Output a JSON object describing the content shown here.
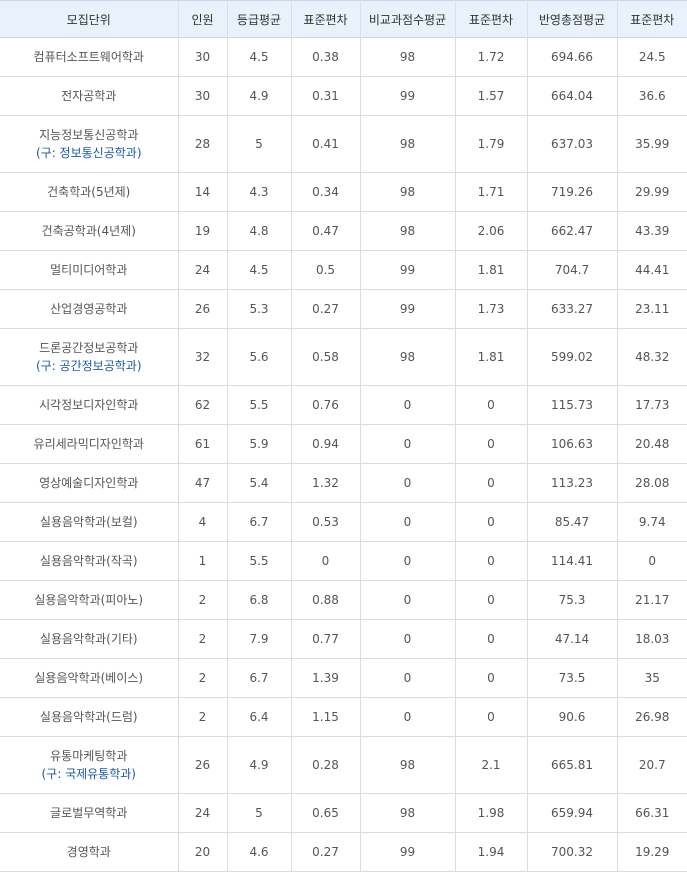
{
  "table": {
    "headers": [
      "모집단위",
      "인원",
      "등급평균",
      "표준편차",
      "비교과점수평균",
      "표준편차",
      "반영총점평균",
      "표준편차"
    ],
    "rows": [
      {
        "name": "컴퓨터소프트웨어학과",
        "sub": "",
        "cells": [
          "30",
          "4.5",
          "0.38",
          "98",
          "1.72",
          "694.66",
          "24.5"
        ]
      },
      {
        "name": "전자공학과",
        "sub": "",
        "cells": [
          "30",
          "4.9",
          "0.31",
          "99",
          "1.57",
          "664.04",
          "36.6"
        ]
      },
      {
        "name": "지능정보통신공학과",
        "sub": "(구: 정보통신공학과)",
        "cells": [
          "28",
          "5",
          "0.41",
          "98",
          "1.79",
          "637.03",
          "35.99"
        ]
      },
      {
        "name": "건축학과(5년제)",
        "sub": "",
        "cells": [
          "14",
          "4.3",
          "0.34",
          "98",
          "1.71",
          "719.26",
          "29.99"
        ]
      },
      {
        "name": "건축공학과(4년제)",
        "sub": "",
        "cells": [
          "19",
          "4.8",
          "0.47",
          "98",
          "2.06",
          "662.47",
          "43.39"
        ]
      },
      {
        "name": "멀티미디어학과",
        "sub": "",
        "cells": [
          "24",
          "4.5",
          "0.5",
          "99",
          "1.81",
          "704.7",
          "44.41"
        ]
      },
      {
        "name": "산업경영공학과",
        "sub": "",
        "cells": [
          "26",
          "5.3",
          "0.27",
          "99",
          "1.73",
          "633.27",
          "23.11"
        ]
      },
      {
        "name": "드론공간정보공학과",
        "sub": "(구: 공간정보공학과)",
        "cells": [
          "32",
          "5.6",
          "0.58",
          "98",
          "1.81",
          "599.02",
          "48.32"
        ]
      },
      {
        "name": "시각정보디자인학과",
        "sub": "",
        "cells": [
          "62",
          "5.5",
          "0.76",
          "0",
          "0",
          "115.73",
          "17.73"
        ]
      },
      {
        "name": "유리세라믹디자인학과",
        "sub": "",
        "cells": [
          "61",
          "5.9",
          "0.94",
          "0",
          "0",
          "106.63",
          "20.48"
        ]
      },
      {
        "name": "영상예술디자인학과",
        "sub": "",
        "cells": [
          "47",
          "5.4",
          "1.32",
          "0",
          "0",
          "113.23",
          "28.08"
        ]
      },
      {
        "name": "실용음악학과(보컬)",
        "sub": "",
        "cells": [
          "4",
          "6.7",
          "0.53",
          "0",
          "0",
          "85.47",
          "9.74"
        ]
      },
      {
        "name": "실용음악학과(작곡)",
        "sub": "",
        "cells": [
          "1",
          "5.5",
          "0",
          "0",
          "0",
          "114.41",
          "0"
        ]
      },
      {
        "name": "실용음악학과(피아노)",
        "sub": "",
        "cells": [
          "2",
          "6.8",
          "0.88",
          "0",
          "0",
          "75.3",
          "21.17"
        ]
      },
      {
        "name": "실용음악학과(기타)",
        "sub": "",
        "cells": [
          "2",
          "7.9",
          "0.77",
          "0",
          "0",
          "47.14",
          "18.03"
        ]
      },
      {
        "name": "실용음악학과(베이스)",
        "sub": "",
        "cells": [
          "2",
          "6.7",
          "1.39",
          "0",
          "0",
          "73.5",
          "35"
        ]
      },
      {
        "name": "실용음악학과(드럼)",
        "sub": "",
        "cells": [
          "2",
          "6.4",
          "1.15",
          "0",
          "0",
          "90.6",
          "26.98"
        ]
      },
      {
        "name": "유통마케팅학과",
        "sub": "(구: 국제유통학과)",
        "cells": [
          "26",
          "4.9",
          "0.28",
          "98",
          "2.1",
          "665.81",
          "20.7"
        ]
      },
      {
        "name": "글로벌무역학과",
        "sub": "",
        "cells": [
          "24",
          "5",
          "0.65",
          "98",
          "1.98",
          "659.94",
          "66.31"
        ]
      },
      {
        "name": "경영학과",
        "sub": "",
        "cells": [
          "20",
          "4.6",
          "0.27",
          "99",
          "1.94",
          "700.32",
          "19.29"
        ]
      }
    ]
  },
  "colors": {
    "header_bg": "#e9f2fb",
    "sub_text": "#1a5aa6",
    "border": "#dcdcdc"
  }
}
